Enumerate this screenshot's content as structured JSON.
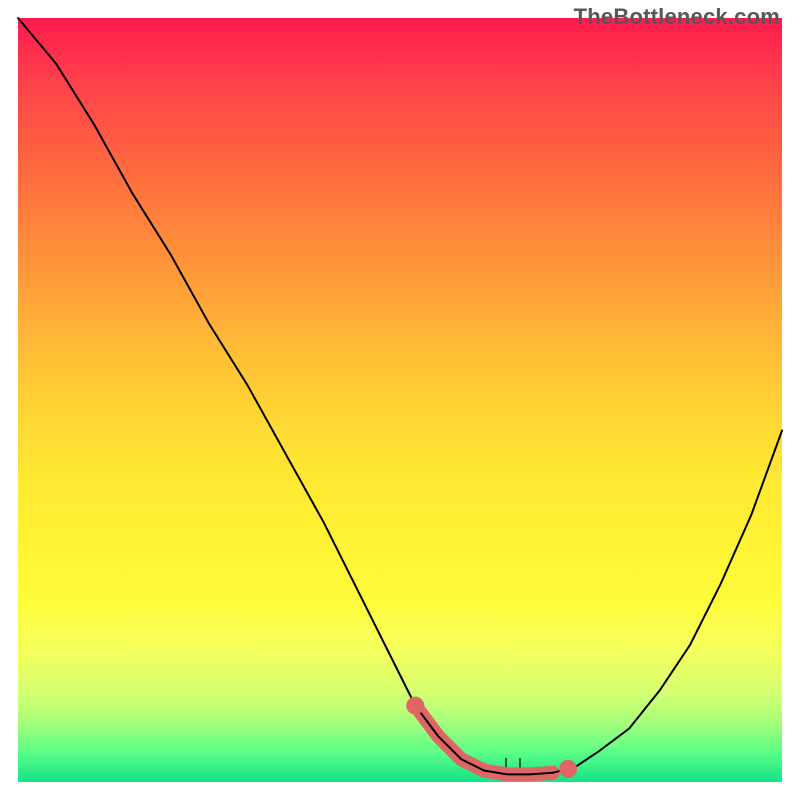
{
  "watermark": "TheBottleneck.com",
  "chart_data": {
    "type": "line",
    "title": "",
    "xlabel": "",
    "ylabel": "",
    "xlim": [
      0,
      100
    ],
    "ylim": [
      0,
      100
    ],
    "series": [
      {
        "name": "curve",
        "x": [
          0,
          5,
          10,
          15,
          20,
          25,
          30,
          35,
          40,
          45,
          50,
          52,
          55,
          58,
          61,
          64,
          67,
          70,
          73,
          76,
          80,
          84,
          88,
          92,
          96,
          100
        ],
        "values": [
          100,
          94,
          86,
          77,
          69,
          60,
          52,
          43,
          34,
          24,
          14,
          10,
          6,
          3,
          1.5,
          1,
          1,
          1.2,
          2,
          4,
          7,
          12,
          18,
          26,
          35,
          46
        ]
      }
    ],
    "highlight": {
      "x_start": 52,
      "x_end": 72,
      "y": 1.2
    },
    "colors": {
      "curve": "#000000",
      "highlight": "#e06666",
      "gradient_top": "#ff1a4d",
      "gradient_bottom": "#14e38a"
    }
  }
}
